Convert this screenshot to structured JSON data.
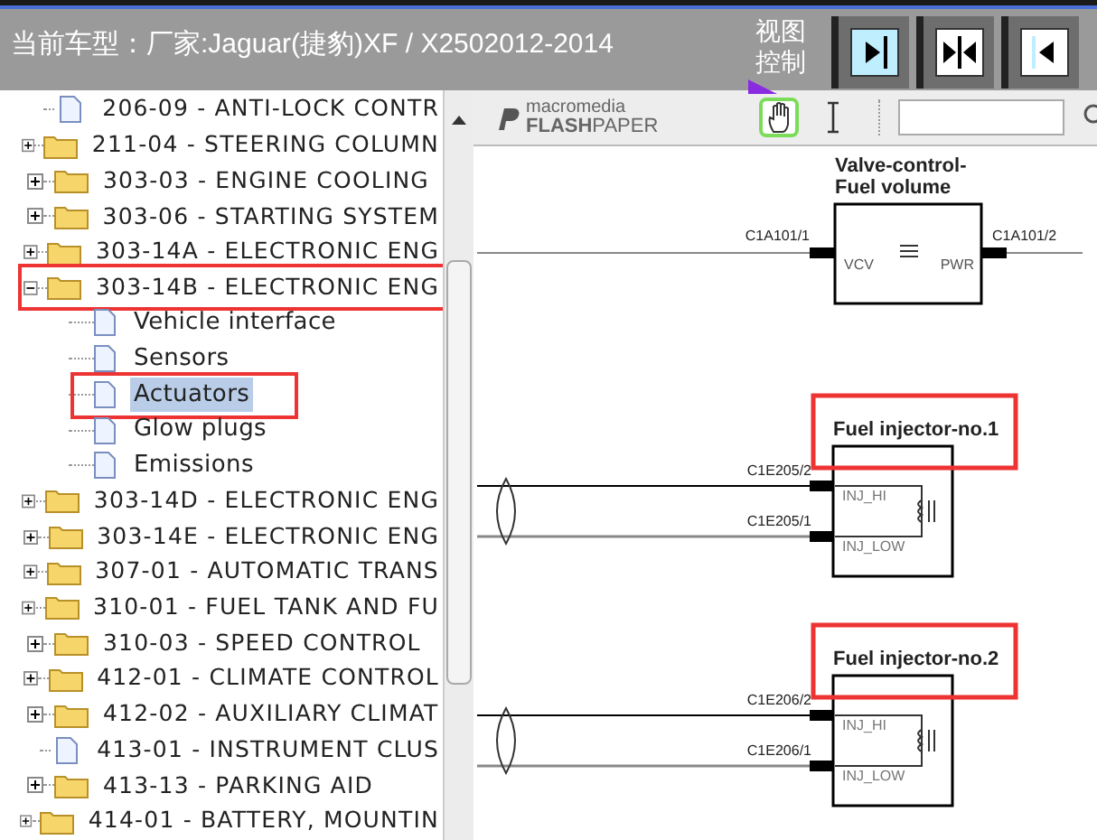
{
  "header": {
    "title": "当前车型：厂家:Jaguar(捷豹)XF / X2502012-2014",
    "view_label": "视图控制"
  },
  "tree": [
    {
      "label": "206-09 - ANTI-LOCK CONTR",
      "kind": "page",
      "selected": false,
      "annotated": false
    },
    {
      "label": "211-04 - STEERING COLUMN",
      "kind": "folder",
      "expanded": false,
      "selected": false,
      "annotated": false
    },
    {
      "label": "303-03 - ENGINE COOLING",
      "kind": "folder",
      "expanded": false,
      "selected": false,
      "annotated": false
    },
    {
      "label": "303-06 - STARTING SYSTEM",
      "kind": "folder",
      "expanded": false,
      "selected": false,
      "annotated": false
    },
    {
      "label": "303-14A - ELECTRONIC ENG",
      "kind": "folder",
      "expanded": false,
      "selected": false,
      "annotated": false
    },
    {
      "label": "303-14B - ELECTRONIC ENG",
      "kind": "folder",
      "expanded": true,
      "selected": false,
      "annotated": true,
      "children": [
        {
          "label": "Vehicle interface",
          "kind": "page",
          "selected": false,
          "annotated": false
        },
        {
          "label": "Sensors",
          "kind": "page",
          "selected": false,
          "annotated": false
        },
        {
          "label": "Actuators",
          "kind": "page",
          "selected": true,
          "annotated": true
        },
        {
          "label": "Glow plugs",
          "kind": "page",
          "selected": false,
          "annotated": false
        },
        {
          "label": "Emissions",
          "kind": "page",
          "selected": false,
          "annotated": false
        }
      ]
    },
    {
      "label": "303-14D - ELECTRONIC ENG",
      "kind": "folder",
      "expanded": false,
      "selected": false,
      "annotated": false
    },
    {
      "label": "303-14E - ELECTRONIC ENG",
      "kind": "folder",
      "expanded": false,
      "selected": false,
      "annotated": false
    },
    {
      "label": "307-01 - AUTOMATIC TRANS",
      "kind": "folder",
      "expanded": false,
      "selected": false,
      "annotated": false
    },
    {
      "label": "310-01 - FUEL TANK AND FU",
      "kind": "folder",
      "expanded": false,
      "selected": false,
      "annotated": false
    },
    {
      "label": "310-03 - SPEED CONTROL",
      "kind": "folder",
      "expanded": false,
      "selected": false,
      "annotated": false
    },
    {
      "label": "412-01 - CLIMATE CONTROL",
      "kind": "folder",
      "expanded": false,
      "selected": false,
      "annotated": false
    },
    {
      "label": "412-02 - AUXILIARY CLIMAT",
      "kind": "folder",
      "expanded": false,
      "selected": false,
      "annotated": false
    },
    {
      "label": "413-01 - INSTRUMENT CLUS",
      "kind": "page",
      "selected": false,
      "annotated": false
    },
    {
      "label": "413-13 - PARKING AID",
      "kind": "folder",
      "expanded": false,
      "selected": false,
      "annotated": false
    },
    {
      "label": "414-01 - BATTERY, MOUNTIN",
      "kind": "folder",
      "expanded": false,
      "selected": false,
      "annotated": false
    }
  ],
  "viewer": {
    "logo_top": "macromedia",
    "logo_bottom": "**FLASH**PAPER",
    "tools": [
      {
        "kind": "hand",
        "selected": true
      },
      {
        "kind": "text",
        "selected": false
      }
    ],
    "components": [
      {
        "kind": "valve",
        "title_lines": [
          "Valve-control-",
          "Fuel volume"
        ],
        "annotated": false,
        "pins": [
          "VCV",
          "PWR"
        ],
        "connectors": [
          "C1A101/1",
          "C1A101/2"
        ]
      },
      {
        "kind": "injector",
        "title_lines": [
          "Fuel injector-no.1"
        ],
        "annotated": true,
        "pins": [
          "INJ_HI",
          "INJ_LOW"
        ],
        "connectors": [
          "C1E205/2",
          "C1E205/1"
        ]
      },
      {
        "kind": "injector",
        "title_lines": [
          "Fuel injector-no.2"
        ],
        "annotated": true,
        "pins": [
          "INJ_HI",
          "INJ_LOW"
        ],
        "connectors": [
          "C1E206/2",
          "C1E206/1"
        ]
      }
    ]
  }
}
